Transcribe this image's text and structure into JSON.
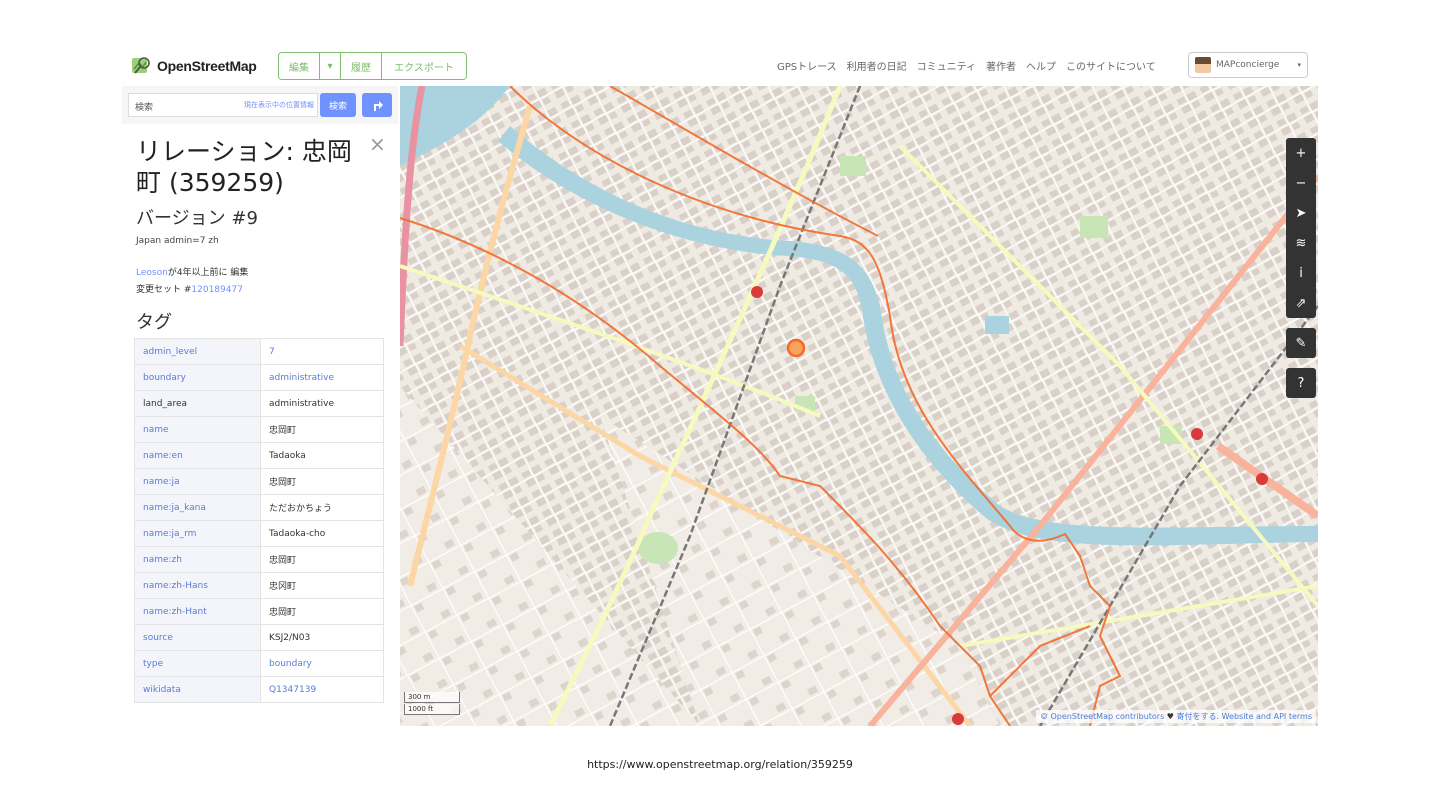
{
  "header": {
    "logo_text": "OpenStreetMap",
    "edit_label": "編集",
    "edit_dropdown_glyph": "▾",
    "history_label": "履歴",
    "export_label": "エクスポート",
    "nav": [
      "GPSトレース",
      "利用者の日記",
      "コミュニティ",
      "著作者",
      "ヘルプ",
      "このサイトについて"
    ],
    "user_name": "MAPconcierge",
    "user_caret": "▾"
  },
  "sidebar": {
    "search_placeholder": "検索",
    "where_am_i": "現在表示中の位置情報",
    "search_button": "検索",
    "close_glyph": "×",
    "title": "リレーション: 忠岡町 (359259)",
    "version": "バージョン #9",
    "comment": "Japan admin=7 zh",
    "edited_user": "Leoson",
    "edited_suffix": "が4年以上前に 編集",
    "changeset_prefix": "変更セット #",
    "changeset_id": "120189477",
    "tags_heading": "タグ",
    "tags": [
      {
        "k": "admin_level",
        "v": "7",
        "k_link": true,
        "v_link": true
      },
      {
        "k": "boundary",
        "v": "administrative",
        "k_link": true,
        "v_link": true
      },
      {
        "k": "land_area",
        "v": "administrative",
        "k_link": false,
        "v_link": false
      },
      {
        "k": "name",
        "v": "忠岡町",
        "k_link": true,
        "v_link": false
      },
      {
        "k": "name:en",
        "v": "Tadaoka",
        "k_link": true,
        "v_link": false
      },
      {
        "k": "name:ja",
        "v": "忠岡町",
        "k_link": true,
        "v_link": false
      },
      {
        "k": "name:ja_kana",
        "v": "ただおかちょう",
        "k_link": true,
        "v_link": false
      },
      {
        "k": "name:ja_rm",
        "v": "Tadaoka-cho",
        "k_link": true,
        "v_link": false
      },
      {
        "k": "name:zh",
        "v": "忠岡町",
        "k_link": true,
        "v_link": false
      },
      {
        "k": "name:zh-Hans",
        "v": "忠冈町",
        "k_link": true,
        "v_link": false
      },
      {
        "k": "name:zh-Hant",
        "v": "忠岡町",
        "k_link": true,
        "v_link": false
      },
      {
        "k": "source",
        "v": "KSJ2/N03",
        "k_link": true,
        "v_link": false
      },
      {
        "k": "type",
        "v": "boundary",
        "k_link": true,
        "v_link": true
      },
      {
        "k": "wikidata",
        "v": "Q1347139",
        "k_link": true,
        "v_link": true
      }
    ]
  },
  "map": {
    "controls": [
      "+",
      "−",
      "➤",
      "≋",
      "i",
      "⇗",
      "✎",
      "?"
    ],
    "scale_top": "300 m",
    "scale_bottom": "1000 ft",
    "attribution_link": "© OpenStreetMap contributors",
    "attribution_heart": "♥",
    "attribution_rest": "寄付をする. Website and API terms",
    "colors": {
      "land": "#efeae2",
      "building": "#d9d0c9",
      "water": "#aad3df",
      "boundary": "#f26a2a",
      "trunk": "#f9b29c",
      "primary": "#fcd6a4",
      "secondary": "#f7fabf",
      "rail": "#777777",
      "park": "#c8e6b5"
    }
  },
  "url": "https://www.openstreetmap.org/relation/359259"
}
